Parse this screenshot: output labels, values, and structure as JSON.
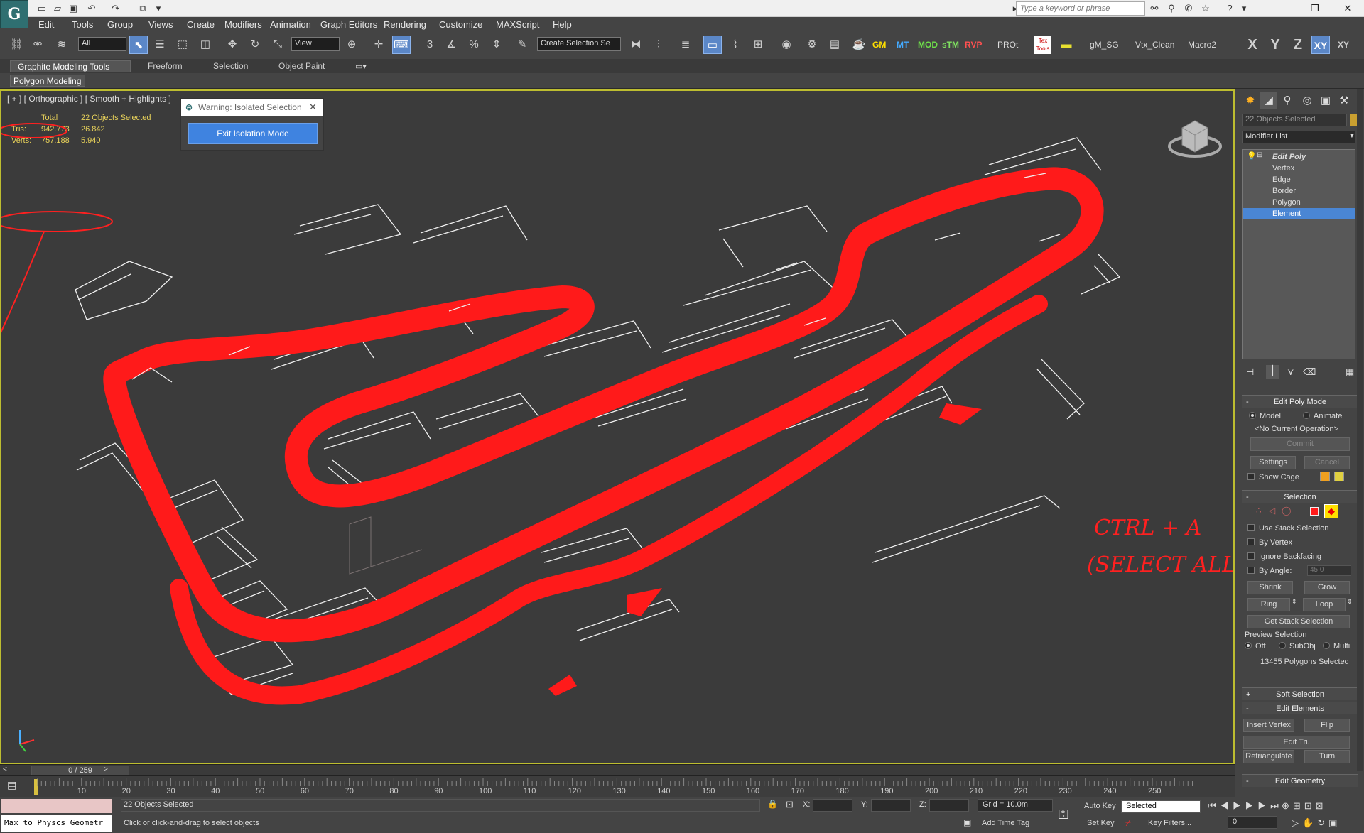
{
  "titlebar": {
    "search_placeholder": "Type a keyword or phrase"
  },
  "menu": [
    "Edit",
    "Tools",
    "Group",
    "Views",
    "Create",
    "Modifiers",
    "Animation",
    "Graph Editors",
    "Rendering",
    "Customize",
    "MAXScript",
    "Help"
  ],
  "toolbar": {
    "selection_filter": "All",
    "reference_coord": "View",
    "named_selection": "Create Selection Se",
    "custom_buttons": [
      "GM",
      "MT",
      "MOD",
      "sTM",
      "RVP",
      "PROt",
      "gM_SG",
      "Vtx_Clean",
      "Macro2"
    ],
    "axis": [
      "X",
      "Y",
      "Z",
      "XY",
      "XY"
    ],
    "textools": "Tex Tools"
  },
  "ribbon": {
    "tabs": [
      "Graphite Modeling Tools",
      "Freeform",
      "Selection",
      "Object Paint"
    ],
    "sub_label": "Polygon Modeling"
  },
  "viewport": {
    "label": "[ + ] [ Orthographic ] [ Smooth + Highlights ]",
    "stats": {
      "header": [
        "",
        "Total",
        "22 Objects Selected"
      ],
      "rows": [
        {
          "label": "Tris:",
          "total": "942.773",
          "selected": "26.842"
        },
        {
          "label": "Verts:",
          "total": "757.188",
          "selected": "5.940"
        }
      ]
    },
    "iso_dialog": {
      "title": "Warning: Isolated Selection",
      "button": "Exit Isolation Mode"
    },
    "annotation_line1": "CTRL + A",
    "annotation_line2": "(SELECT ALL)",
    "colors": {
      "selection": "#ff1a1a",
      "wire": "#f0f0f0"
    }
  },
  "command_panel": {
    "object_name": "22 Objects Selected",
    "modifier_list": "Modifier List",
    "stack": {
      "modifier": "Edit Poly",
      "items": [
        "Vertex",
        "Edge",
        "Border",
        "Polygon",
        "Element"
      ],
      "selected": "Element"
    },
    "edit_poly_mode": {
      "title": "Edit Poly Mode",
      "model": "Model",
      "animate": "Animate",
      "operation": "<No Current Operation>",
      "commit": "Commit",
      "settings": "Settings",
      "cancel": "Cancel",
      "show_cage": "Show Cage"
    },
    "selection": {
      "title": "Selection",
      "use_stack": "Use Stack Selection",
      "by_vertex": "By Vertex",
      "ignore_backfacing": "Ignore Backfacing",
      "by_angle": "By Angle:",
      "angle_value": "45.0",
      "shrink": "Shrink",
      "grow": "Grow",
      "ring": "Ring",
      "loop": "Loop",
      "get_stack": "Get Stack Selection",
      "preview_title": "Preview Selection",
      "preview_off": "Off",
      "preview_subobj": "SubObj",
      "preview_multi": "Multi",
      "count": "13455 Polygons Selected"
    },
    "soft_selection": "Soft Selection",
    "edit_elements": {
      "title": "Edit Elements",
      "insert_vertex": "Insert Vertex",
      "flip": "Flip",
      "edit_tri": "Edit Tri.",
      "retriangulate": "Retriangulate",
      "turn": "Turn"
    },
    "edit_geometry": "Edit Geometry"
  },
  "timeline": {
    "slider": "0 / 259",
    "ticks": [
      "10",
      "20",
      "30",
      "40",
      "50",
      "60",
      "70",
      "80",
      "90",
      "100",
      "110",
      "120",
      "130",
      "140",
      "150",
      "160",
      "170",
      "180",
      "190",
      "200",
      "210",
      "220",
      "230",
      "240",
      "250"
    ]
  },
  "status": {
    "selected": "22 Objects Selected",
    "prompt": "Click or click-and-drag to select objects",
    "maxscript": "Max to Physcs Geometr",
    "x_label": "X:",
    "y_label": "Y:",
    "z_label": "Z:",
    "grid": "Grid = 10.0m",
    "add_time_tag": "Add Time Tag",
    "auto_key": "Auto Key",
    "set_key": "Set Key",
    "key_mode": "Selected",
    "key_filters": "Key Filters...",
    "frame": "0"
  }
}
